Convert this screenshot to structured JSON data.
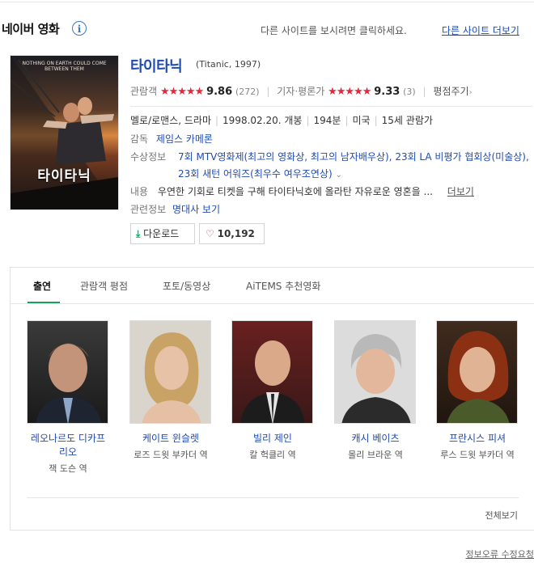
{
  "header": {
    "title": "네이버 영화",
    "info_icon": "i",
    "other_site_text": "다른 사이트를 보시려면 클릭하세요.",
    "other_site_link": "다른 사이트 더보기"
  },
  "movie": {
    "poster_title": "타이타닉",
    "poster_tagline": "NOTHING ON EARTH COULD COME BETWEEN THEM",
    "title": "타이타닉",
    "original": "(Titanic, 1997)",
    "audience_label": "관람객",
    "audience_stars": "★★★★★",
    "audience_score": "9.86",
    "audience_count": "(272)",
    "critic_label": "기자·평론가",
    "critic_stars": "★★★★★",
    "critic_score": "9.33",
    "critic_count": "(3)",
    "rate_link": "평점주기",
    "genre": "멜로/로맨스, 드라마",
    "release": "1998.02.20. 개봉",
    "runtime": "194분",
    "country": "미국",
    "rating": "15세 관람가",
    "director_label": "감독",
    "director": "제임스 카메론",
    "award_label": "수상정보",
    "award_text": "7회 MTV영화제(최고의 영화상, 최고의 남자배우상), 23회 LA 비평가 협회상(미술상), 23회 새턴 어워즈(최우수 여우조연상)",
    "content_label": "내용",
    "content_text": "우연한 기회로 티켓을 구해 타이타닉호에 올라탄 자유로운 영혼을 ...",
    "content_more": "더보기",
    "related_label": "관련정보",
    "related_link": "명대사 보기",
    "download_label": "다운로드",
    "like_count": "10,192"
  },
  "tabs": [
    {
      "label": "출연"
    },
    {
      "label": "관람객 평점"
    },
    {
      "label": "포토/동영상"
    },
    {
      "label": "AiTEMS 추천영화"
    }
  ],
  "cast": [
    {
      "name": "레오나르도 디카프리오",
      "role": "잭 도슨 역"
    },
    {
      "name": "케이트 윈슬렛",
      "role": "로즈 드윗 부카더 역"
    },
    {
      "name": "빌리 제인",
      "role": "칼 헉클리 역"
    },
    {
      "name": "캐시 베이츠",
      "role": "몰리 브라운 역"
    },
    {
      "name": "프란시스 피셔",
      "role": "루스 드윗 부카더 역"
    }
  ],
  "view_all": "전체보기",
  "report_link": "정보오류 수정요청",
  "colors": {
    "link_blue": "#1f4bb4",
    "star_red": "#e8263c",
    "tab_green": "#19a05c"
  }
}
